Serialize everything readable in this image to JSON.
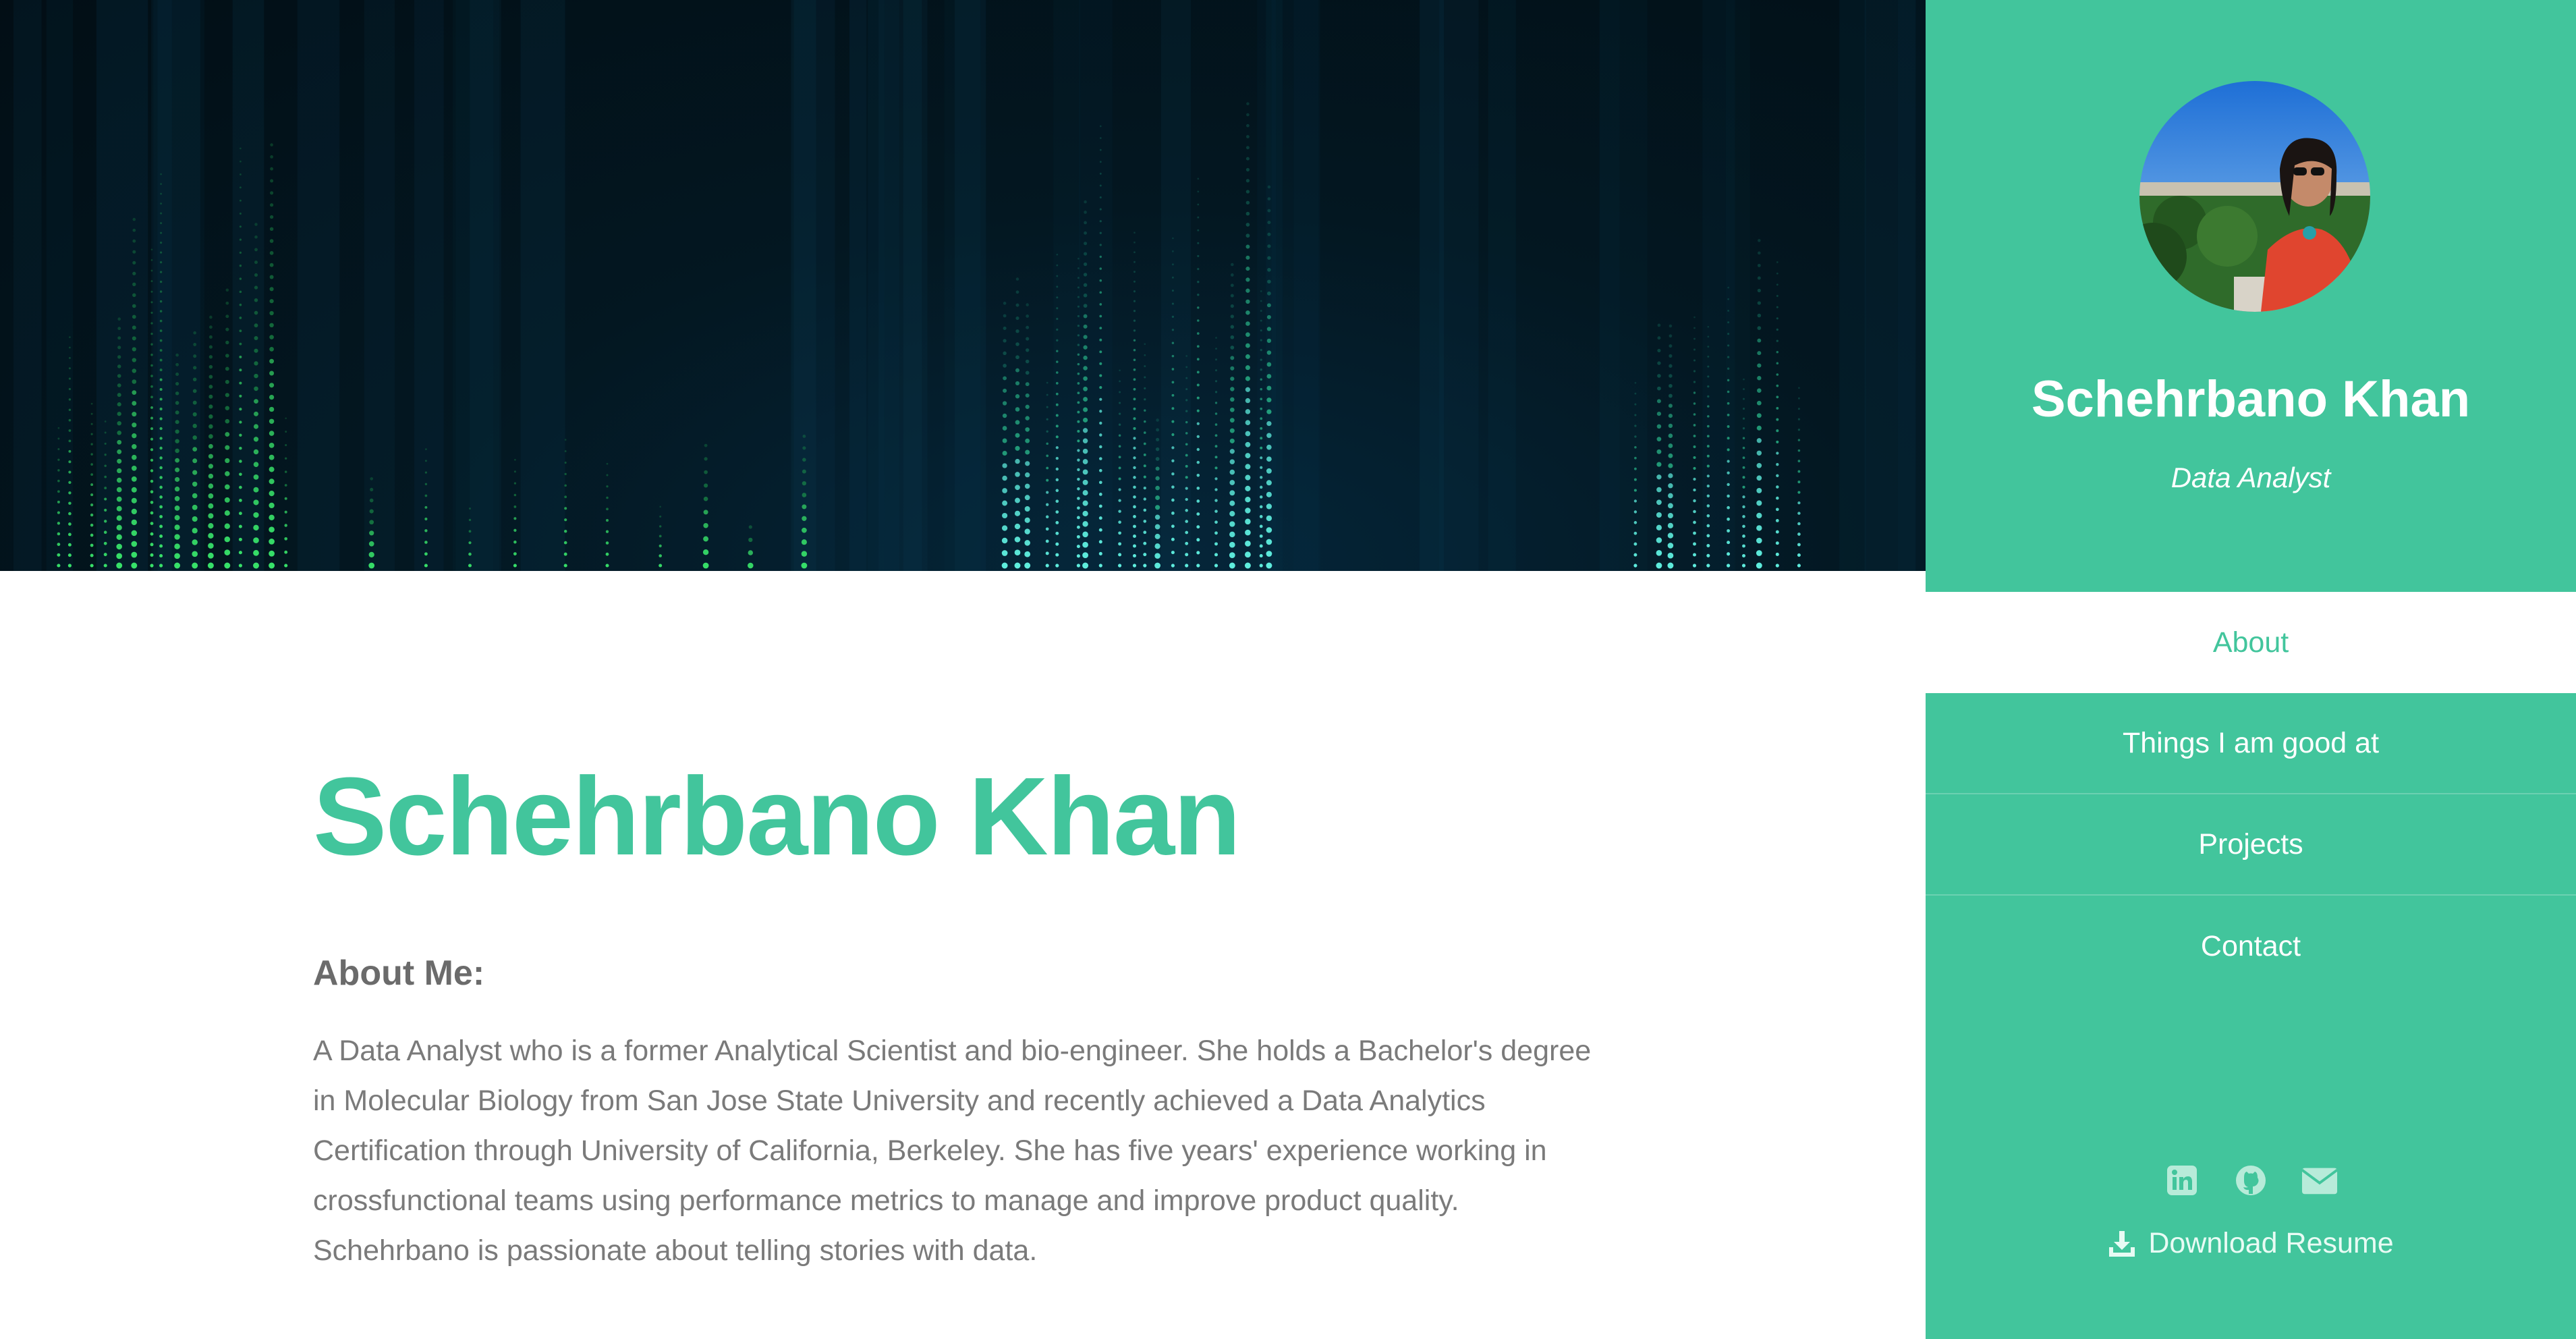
{
  "main": {
    "name": "Schehrbano Khan",
    "about_heading": "About Me:",
    "about_text": "A Data Analyst who is a former Analytical Scientist and bio-engineer. She holds a Bachelor's degree in Molecular Biology from San Jose State University and recently achieved a Data Analytics Certification through University of California, Berkeley. She has five years' experience working in crossfunctional teams using performance metrics to manage and improve product quality. Schehrbano is passionate about telling stories with data."
  },
  "sidebar": {
    "name": "Schehrbano Khan",
    "role": "Data Analyst",
    "nav": [
      {
        "label": "About",
        "active": true
      },
      {
        "label": "Things I am good at",
        "active": false
      },
      {
        "label": "Projects",
        "active": false
      },
      {
        "label": "Contact",
        "active": false
      }
    ],
    "social_icons": [
      "linkedin-icon",
      "github-icon",
      "envelope-icon"
    ],
    "download_label": "Download Resume",
    "download_icon": "download-icon"
  },
  "colors": {
    "accent": "#42c59c",
    "hero_background": "#031721",
    "body_text": "#7a7a7a",
    "heading_text": "#6b6b6b"
  }
}
